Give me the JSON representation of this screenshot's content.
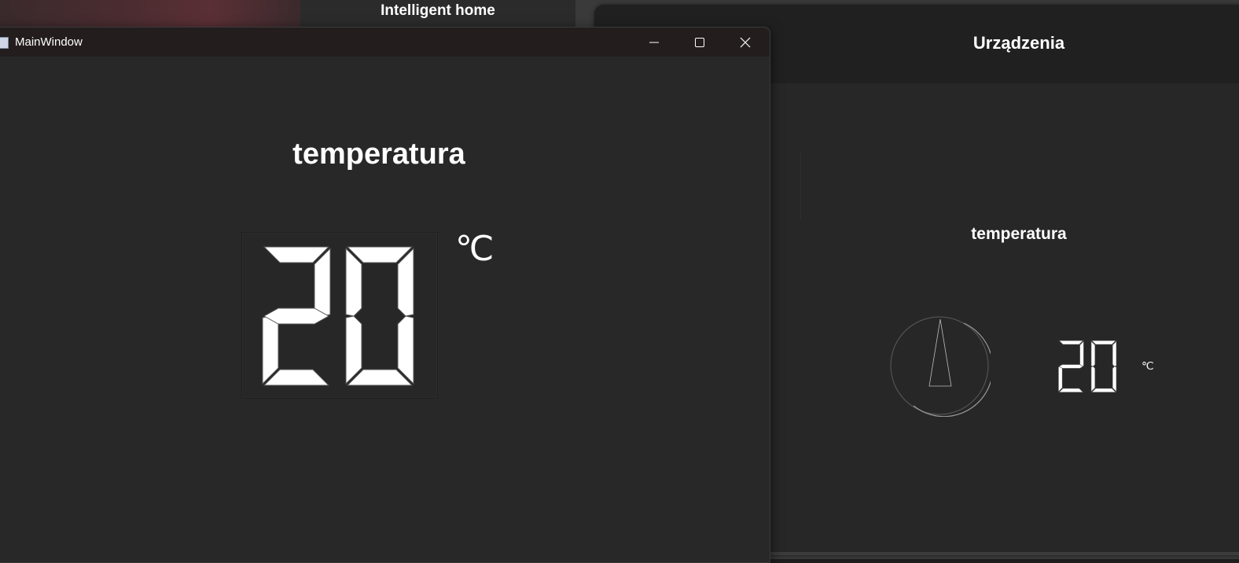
{
  "background": {
    "top_window_title": "Intelligent home"
  },
  "devices_window": {
    "header_title": "Urządzenia",
    "sensor_label": "temperatura",
    "gauge_needle_value": 20,
    "reading": "20",
    "unit": "℃"
  },
  "main_window": {
    "title": "MainWindow",
    "controls": {
      "minimize": "minimize-icon",
      "maximize": "maximize-icon",
      "close": "close-icon"
    },
    "heading": "temperatura",
    "reading": "20",
    "unit": "℃"
  },
  "colors": {
    "window_bg": "#282828",
    "titlebar_bg": "#231d1e",
    "lcd_fill": "#ffffff",
    "lcd_outline": "#555555"
  }
}
